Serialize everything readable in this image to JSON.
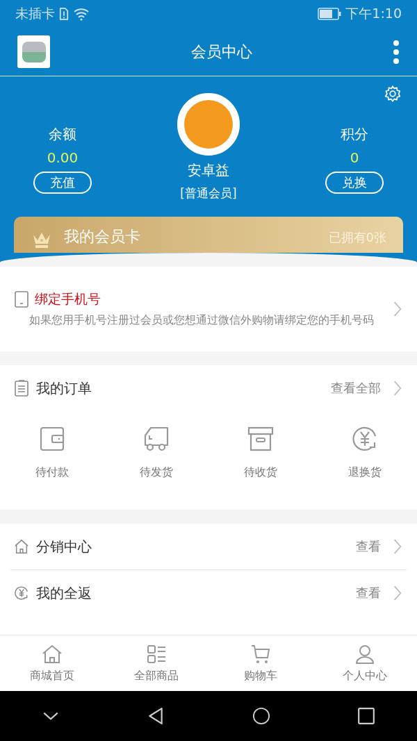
{
  "status_bar": {
    "carrier": "未插卡",
    "time": "下午1:10"
  },
  "header": {
    "title": "会员中心"
  },
  "profile": {
    "balance": {
      "label": "余额",
      "value": "0.00",
      "button": "充值"
    },
    "name": "安卓益",
    "level": "[普通会员]",
    "points": {
      "label": "积分",
      "value": "0",
      "button": "兑换"
    }
  },
  "member_card": {
    "title": "我的会员卡",
    "count": "已拥有0张"
  },
  "bind_phone": {
    "title": "绑定手机号",
    "description": "如果您用手机号注册过会员或您想通过微信外购物请绑定您的手机号码"
  },
  "orders": {
    "title": "我的订单",
    "link": "查看全部",
    "statuses": [
      {
        "kind": "wallet",
        "label": "待付款"
      },
      {
        "kind": "truck",
        "label": "待发货"
      },
      {
        "kind": "box",
        "label": "待收货"
      },
      {
        "kind": "refund",
        "label": "退换货"
      }
    ]
  },
  "menu": [
    {
      "kind": "home",
      "label": "分销中心",
      "link": "查看"
    },
    {
      "kind": "refund",
      "label": "我的全返",
      "link": "查看"
    }
  ],
  "tab_bar": [
    {
      "kind": "home",
      "label": "商城首页"
    },
    {
      "kind": "grid",
      "label": "全部商品"
    },
    {
      "kind": "cart",
      "label": "购物车"
    },
    {
      "kind": "person",
      "label": "个人中心"
    }
  ]
}
